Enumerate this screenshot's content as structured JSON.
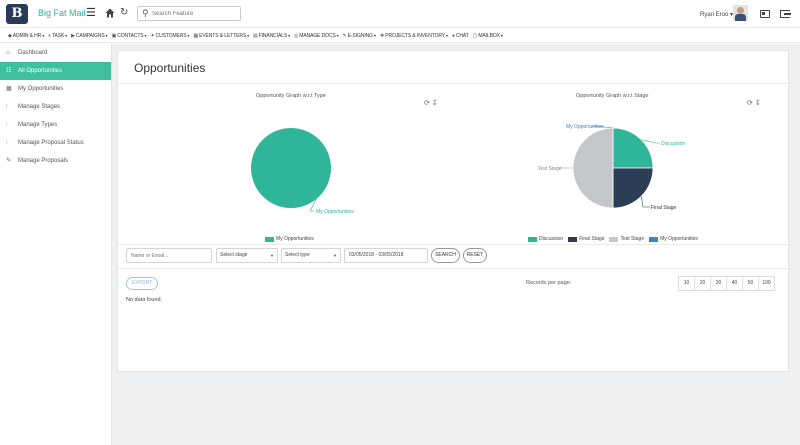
{
  "header": {
    "logo_letter": "B",
    "brand": "Big Fat Mail",
    "search_placeholder": "Search Feature",
    "user_name": "Ryan Eroo"
  },
  "menu": [
    {
      "label": "ADMIN & HR",
      "icon": "shield-icon"
    },
    {
      "label": "TASK",
      "icon": "tasks-icon"
    },
    {
      "label": "CAMPAIGNS",
      "icon": "megaphone-icon"
    },
    {
      "label": "CONTACTS",
      "icon": "contacts-icon"
    },
    {
      "label": "CUSTOMERS",
      "icon": "handshake-icon"
    },
    {
      "label": "EVENTS & LETTERS",
      "icon": "calendar-icon"
    },
    {
      "label": "FINANCIALS",
      "icon": "money-icon"
    },
    {
      "label": "MANAGE DOCS",
      "icon": "document-icon"
    },
    {
      "label": "E-SIGNING",
      "icon": "pen-icon"
    },
    {
      "label": "PROJECTS & INVENTORY",
      "icon": "cubes-icon"
    },
    {
      "label": "CHAT",
      "icon": "chat-icon"
    },
    {
      "label": "MAILBOX",
      "icon": "mailbox-icon"
    }
  ],
  "sidebar": {
    "items": [
      {
        "label": "Dashboard",
        "icon": "home-icon",
        "active": false
      },
      {
        "label": "All Opportunities",
        "icon": "list-icon",
        "active": true
      },
      {
        "label": "My Opportunities",
        "icon": "calendar-icon",
        "active": false
      },
      {
        "label": "Manage Stages",
        "icon": "sliders-icon",
        "active": false
      },
      {
        "label": "Manage Types",
        "icon": "sliders-icon",
        "active": false
      },
      {
        "label": "Manage Proposal Status",
        "icon": "sliders-icon",
        "active": false
      },
      {
        "label": "Manage Proposals",
        "icon": "pencil-icon",
        "active": false
      }
    ]
  },
  "main": {
    "title": "Opportunities",
    "filters": {
      "name_placeholder": "Name or Email...",
      "stage_select": "Select stage",
      "type_select": "Select type",
      "date_range": "03/05/2018 - 03/05/2018",
      "search_label": "SEARCH",
      "reset_label": "RESET"
    },
    "export_label": "EXPORT",
    "no_data": "No data found.",
    "records_label": "Records per page:",
    "page_sizes": [
      "10",
      "20",
      "30",
      "40",
      "50",
      "100"
    ]
  },
  "colors": {
    "accent": "#2db2a6",
    "active_sidebar": "#3dbfa0",
    "teal": "#2fb597",
    "navy": "#2b3e55",
    "gray": "#c4c8cc",
    "blue": "#3b87c8"
  },
  "chart_data": [
    {
      "type": "pie",
      "title": "Opportunity Graph w.r.t Type",
      "categories": [
        "My Opportunities"
      ],
      "values": [
        100
      ],
      "colors": [
        "#2fb597"
      ],
      "legend": "bottom"
    },
    {
      "type": "pie",
      "title": "Opportunity Graph w.r.t Stage",
      "categories": [
        "Discussion",
        "Final Stage",
        "Test Stage",
        "My Opportunities"
      ],
      "values": [
        25,
        25,
        50,
        0
      ],
      "colors": [
        "#2fb597",
        "#2b3e55",
        "#c4c8cc",
        "#3b87c8"
      ],
      "point_labels": [
        "Discussion",
        "Final Stage",
        "Test Stage",
        "My Opportunities"
      ],
      "legend": "bottom"
    }
  ]
}
